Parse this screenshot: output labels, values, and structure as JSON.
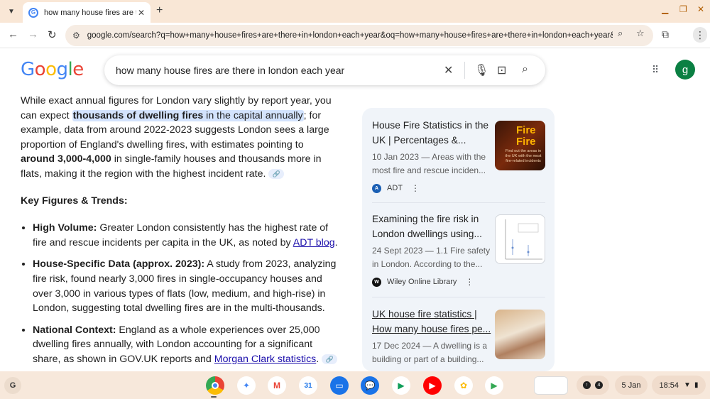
{
  "browser": {
    "tab_title": "how many house fires are there",
    "tab_close": "✕",
    "new_tab": "+",
    "url": "google.com/search?q=how+many+house+fires+are+there+in+london+each+year&oq=how+many+house+fires+are+there+in+london+each+year&gs_lc..."
  },
  "google": {
    "logo_letters": [
      "G",
      "o",
      "o",
      "g",
      "l",
      "e"
    ],
    "query": "how many house fires are there in london each year",
    "avatar_letter": "g"
  },
  "overview": {
    "p1_a": "While exact annual figures for London vary slightly by report year, you can expect ",
    "p1_hl_bold": "thousands of dwelling fires",
    "p1_hl_rest": " in the capital annually",
    "p1_b": "; for example, data from around 2022-2023 suggests London sees a large proportion of England's dwelling fires, with estimates pointing to ",
    "p1_bold": "around 3,000-4,000",
    "p1_c": " in single-family houses and thousands more in flats, making it the region with the highest incident rate.",
    "section_head": "Key Figures & Trends:",
    "b1_label": "High Volume:",
    "b1_text": " Greater London consistently has the highest rate of fire and rescue incidents per capita in the UK, as noted by ",
    "b1_link": "ADT blog",
    "b1_end": ".",
    "b2_label": "House-Specific Data (approx. 2023):",
    "b2_text": " A study from 2023, analyzing fire risk, found nearly 3,000 fires in single-occupancy houses and over 3,000 in various types of flats (low, medium, and high-rise) in London, suggesting total dwelling fires are in the multi-thousands.",
    "b3_label": "National Context:",
    "b3_text": " England as a whole experiences over 25,000 dwelling fires annually, with London accounting for a significant share, as shown in GOV.UK reports and ",
    "b3_link": "Morgan Clark statistics",
    "b3_end": "."
  },
  "sources": [
    {
      "title": "House Fire Statistics in the UK | Percentages &...",
      "snippet": "10 Jan 2023 — Areas with the most fire and rescue inciden...",
      "source": "ADT",
      "thumb_title": "Fire Fire",
      "thumb_sub": "Find out the areas in the UK with the most fire-related incidents"
    },
    {
      "title": "Examining the fire risk in London dwellings using...",
      "snippet": "24 Sept 2023 — 1.1 Fire safety in London. According to the...",
      "source": "Wiley Online Library"
    },
    {
      "title": "UK house fire statistics | How many house fires pe...",
      "snippet": "17 Dec 2024 — A dwelling is a building or part of a building..."
    }
  ],
  "taskbar": {
    "launcher": "G",
    "download_count": "4",
    "date": "5 Jan",
    "time": "18:54"
  },
  "colors": {
    "tabstrip": "#f9e7d6",
    "highlight": "#d3e3fd",
    "sources_bg": "#f0f4f9",
    "link": "#1a0dab"
  }
}
